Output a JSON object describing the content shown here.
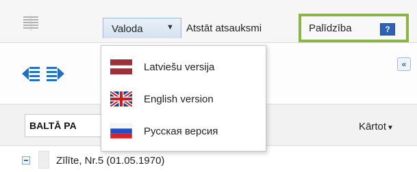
{
  "toolbar": {
    "language_label": "Valoda",
    "feedback_label": "Atstāt atsauksmi",
    "help_label": "Palīdzība",
    "help_icon_glyph": "?"
  },
  "language_menu": {
    "items": [
      {
        "label": "Latviešu versija",
        "icon": "latvian-flag-icon"
      },
      {
        "label": "English version",
        "icon": "uk-flag-icon"
      },
      {
        "label": "Русская версия",
        "icon": "russian-flag-icon"
      }
    ]
  },
  "nav": {
    "collapse_glyph": "«"
  },
  "filter": {
    "value": "BALTĀ PA",
    "sort_label": "Kārtot"
  },
  "tree": {
    "items": [
      {
        "label": "Zīlīte, Nr.5 (01.05.1970)"
      }
    ]
  },
  "colors": {
    "help_highlight": "#8ab444",
    "accent_blue": "#2b62b5"
  }
}
